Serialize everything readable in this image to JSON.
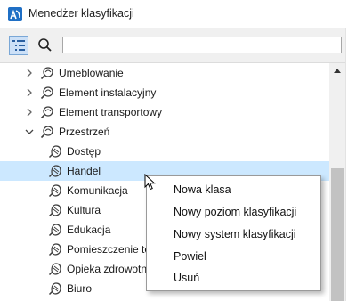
{
  "window": {
    "title": "Menedżer klasyfikacji"
  },
  "toolbar": {
    "search_value": "",
    "search_placeholder": ""
  },
  "tree": {
    "groups": [
      "Umeblowanie",
      "Element instalacyjny",
      "Element transportowy",
      "Przestrzeń"
    ],
    "children": [
      "Dostęp",
      "Handel",
      "Komunikacja",
      "Kultura",
      "Edukacja",
      "Pomieszczenie tec",
      "Opieka zdrowotn",
      "Biuro"
    ],
    "selected_item": "Handel"
  },
  "context_menu": {
    "items": [
      "Nowa klasa",
      "Nowy poziom klasyfikacji",
      "Nowy system klasyfikacji",
      "Powiel",
      "Usuń"
    ]
  },
  "colors": {
    "accent": "#1f6fc5",
    "selection": "#cce8ff",
    "icon": "#3d3d3d"
  }
}
